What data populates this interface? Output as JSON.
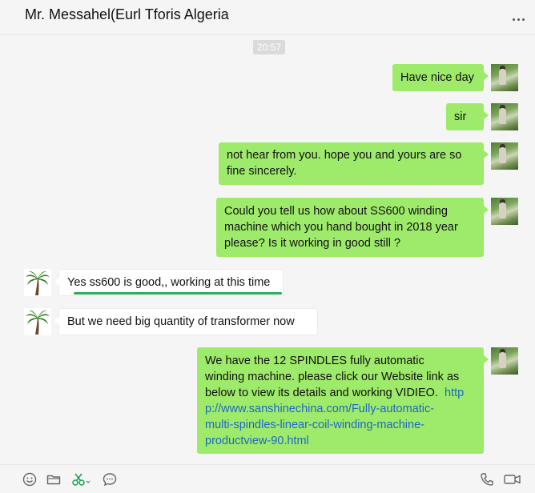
{
  "header": {
    "title": "Mr. Messahel(Eurl Tforis Algeria",
    "more_icon": "more-dots-icon"
  },
  "timestamp": "20:57",
  "messages": [
    {
      "sender": "me",
      "text": "Have nice day"
    },
    {
      "sender": "me",
      "text": "sir"
    },
    {
      "sender": "me",
      "lines": [
        "not hear from you. hope you and yours are so",
        "fine sincerely."
      ]
    },
    {
      "sender": "me",
      "lines": [
        "Could you tell us how about SS600 winding",
        "machine which you hand bought in 2018 year",
        "please? Is it working in good still ?"
      ]
    },
    {
      "sender": "them",
      "text": "Yes ss600 is good,, working at this time"
    },
    {
      "sender": "them",
      "text": "But we need big quantity of transformer now"
    },
    {
      "sender": "me",
      "lines": [
        "We have the 12 SPINDLES fully automatic",
        "winding machine. please click our Website link as",
        "below to view its details and working VIDIEO."
      ],
      "link_parts": [
        "http",
        "p://www.sanshinechina.com/Fully-automatic-",
        "multi-spindles-linear-coil-winding-machine-",
        "productview-90.html"
      ]
    }
  ],
  "toolbar": {
    "left_icons": [
      "emoji-icon",
      "folder-icon",
      "scissors-icon",
      "chat-history-icon"
    ],
    "right_icons": [
      "phone-icon",
      "video-call-icon"
    ]
  },
  "colors": {
    "my_bubble": "#9eea6a",
    "their_bubble": "#ffffff",
    "link": "#1d68c7",
    "highlight_underline": "#2aae5a"
  }
}
